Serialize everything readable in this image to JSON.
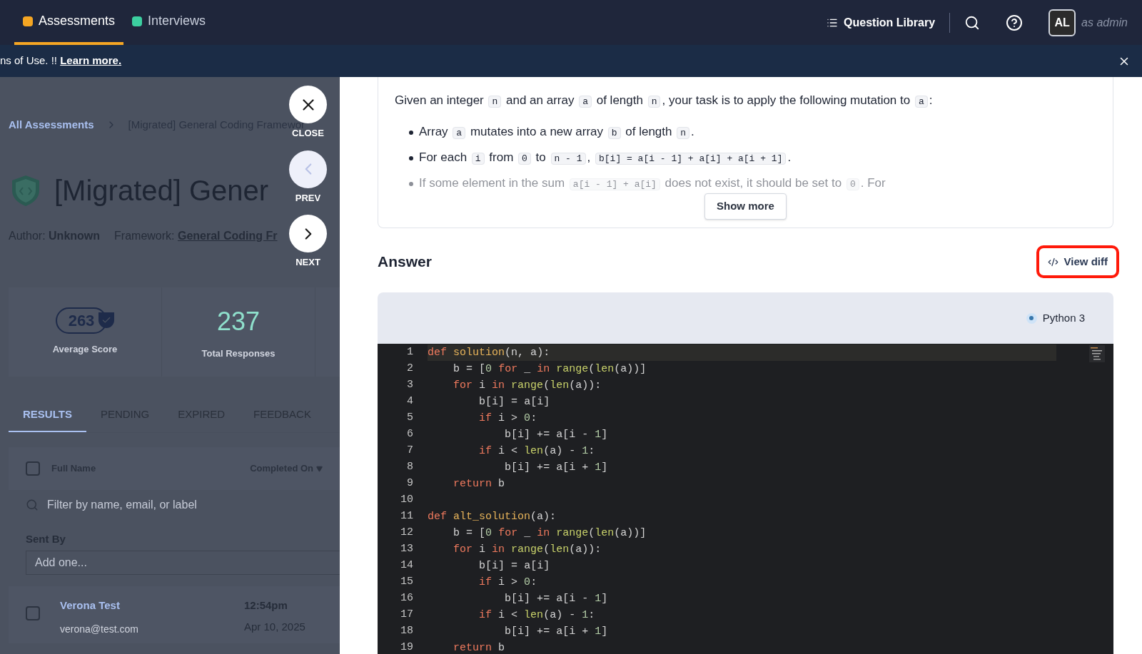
{
  "nav": {
    "tabs": [
      {
        "label": "Assessments",
        "selected": true,
        "color": "#f5a623"
      },
      {
        "label": "Interviews",
        "selected": false,
        "color": "#3ccfa0"
      }
    ],
    "question_library": "Question Library",
    "avatar": "AL",
    "role": "as admin"
  },
  "banner": {
    "text": "ns of Use. !! ",
    "link": "Learn more."
  },
  "background_page": {
    "breadcrumb": {
      "root": "All Assessments",
      "current": "[Migrated] General Coding Framewor"
    },
    "title": "[Migrated] Gener",
    "author_label": "Author:",
    "author": "Unknown",
    "framework_label": "Framework:",
    "framework": "General Coding Fr",
    "average_score": "263",
    "average_score_label": "Average Score",
    "total_responses": "237",
    "total_responses_label": "Total Responses",
    "tabs": [
      {
        "label": "RESULTS",
        "selected": true
      },
      {
        "label": "PENDING",
        "selected": false
      },
      {
        "label": "EXPIRED",
        "selected": false
      },
      {
        "label": "FEEDBACK",
        "selected": false
      }
    ],
    "select_all_checked": false,
    "columns": [
      "Full Name",
      "Completed On"
    ],
    "filter_placeholder": "Filter by name, email, or label",
    "sent_by_label": "Sent By",
    "sent_by_placeholder": "Add one...",
    "rows": [
      {
        "name": "Verona Test",
        "email": "verona@test.com",
        "time": "12:54pm",
        "date": "Apr 10, 2025",
        "checked": false
      }
    ]
  },
  "side_controls": [
    {
      "kind": "close",
      "label": "CLOSE",
      "disabled": false
    },
    {
      "kind": "prev",
      "label": "PREV",
      "disabled": true
    },
    {
      "kind": "next",
      "label": "NEXT",
      "disabled": false
    }
  ],
  "description": {
    "intro": [
      {
        "kind": "text",
        "text": "Given an integer "
      },
      {
        "kind": "code",
        "text": "n"
      },
      {
        "kind": "text",
        "text": " and an array "
      },
      {
        "kind": "code",
        "text": "a"
      },
      {
        "kind": "text",
        "text": " of length "
      },
      {
        "kind": "code",
        "text": "n"
      },
      {
        "kind": "text",
        "text": ", your task is to apply the following mutation to "
      },
      {
        "kind": "code",
        "text": "a"
      },
      {
        "kind": "text",
        "text": ":"
      }
    ],
    "bullets": [
      [
        {
          "kind": "text",
          "text": "Array "
        },
        {
          "kind": "code",
          "text": "a"
        },
        {
          "kind": "text",
          "text": " mutates into a new array "
        },
        {
          "kind": "code",
          "text": "b"
        },
        {
          "kind": "text",
          "text": " of length "
        },
        {
          "kind": "code",
          "text": "n"
        },
        {
          "kind": "text",
          "text": "."
        }
      ],
      [
        {
          "kind": "text",
          "text": "For each "
        },
        {
          "kind": "code",
          "text": "i"
        },
        {
          "kind": "text",
          "text": " from "
        },
        {
          "kind": "code",
          "text": "0"
        },
        {
          "kind": "text",
          "text": " to "
        },
        {
          "kind": "code",
          "text": "n - 1"
        },
        {
          "kind": "text",
          "text": ", "
        },
        {
          "kind": "code",
          "text": "b[i] = a[i - 1] + a[i] + a[i + 1]"
        },
        {
          "kind": "text",
          "text": "."
        }
      ],
      [
        {
          "kind": "text",
          "text": "If some element in the sum "
        },
        {
          "kind": "code",
          "text": "a[i - 1] + a[i]"
        },
        {
          "kind": "text",
          "text": " does not exist, it should be set to "
        },
        {
          "kind": "code",
          "text": "0"
        },
        {
          "kind": "text",
          "text": ". For"
        }
      ]
    ],
    "show_more": "Show more"
  },
  "answer": {
    "title": "Answer",
    "view_diff": "View diff",
    "language": "Python 3",
    "lines": [
      {
        "number": "1",
        "code": "def solution(n, a):",
        "highlighted": true
      },
      {
        "number": "2",
        "code": "    b = [0 for _ in range(len(a))]",
        "highlighted": false
      },
      {
        "number": "3",
        "code": "    for i in range(len(a)):",
        "highlighted": false
      },
      {
        "number": "4",
        "code": "        b[i] = a[i]",
        "highlighted": false
      },
      {
        "number": "5",
        "code": "        if i > 0:",
        "highlighted": false
      },
      {
        "number": "6",
        "code": "            b[i] += a[i - 1]",
        "highlighted": false
      },
      {
        "number": "7",
        "code": "        if i < len(a) - 1:",
        "highlighted": false
      },
      {
        "number": "8",
        "code": "            b[i] += a[i + 1]",
        "highlighted": false
      },
      {
        "number": "9",
        "code": "    return b",
        "highlighted": false
      },
      {
        "number": "10",
        "highlighted": false
      },
      {
        "number": "11",
        "code": "def alt_solution(a):",
        "highlighted": false
      },
      {
        "number": "12",
        "code": "    b = [0 for _ in range(len(a))]",
        "highlighted": false
      },
      {
        "number": "13",
        "code": "    for i in range(len(a)):",
        "highlighted": false
      },
      {
        "number": "14",
        "code": "        b[i] = a[i]",
        "highlighted": false
      },
      {
        "number": "15",
        "code": "        if i > 0:",
        "highlighted": false
      },
      {
        "number": "16",
        "code": "            b[i] += a[i - 1]",
        "highlighted": false
      },
      {
        "number": "17",
        "code": "        if i < len(a) - 1:",
        "highlighted": false
      },
      {
        "number": "18",
        "code": "            b[i] += a[i + 1]",
        "highlighted": false
      },
      {
        "number": "19",
        "code": "    return b",
        "highlighted": false
      }
    ]
  }
}
